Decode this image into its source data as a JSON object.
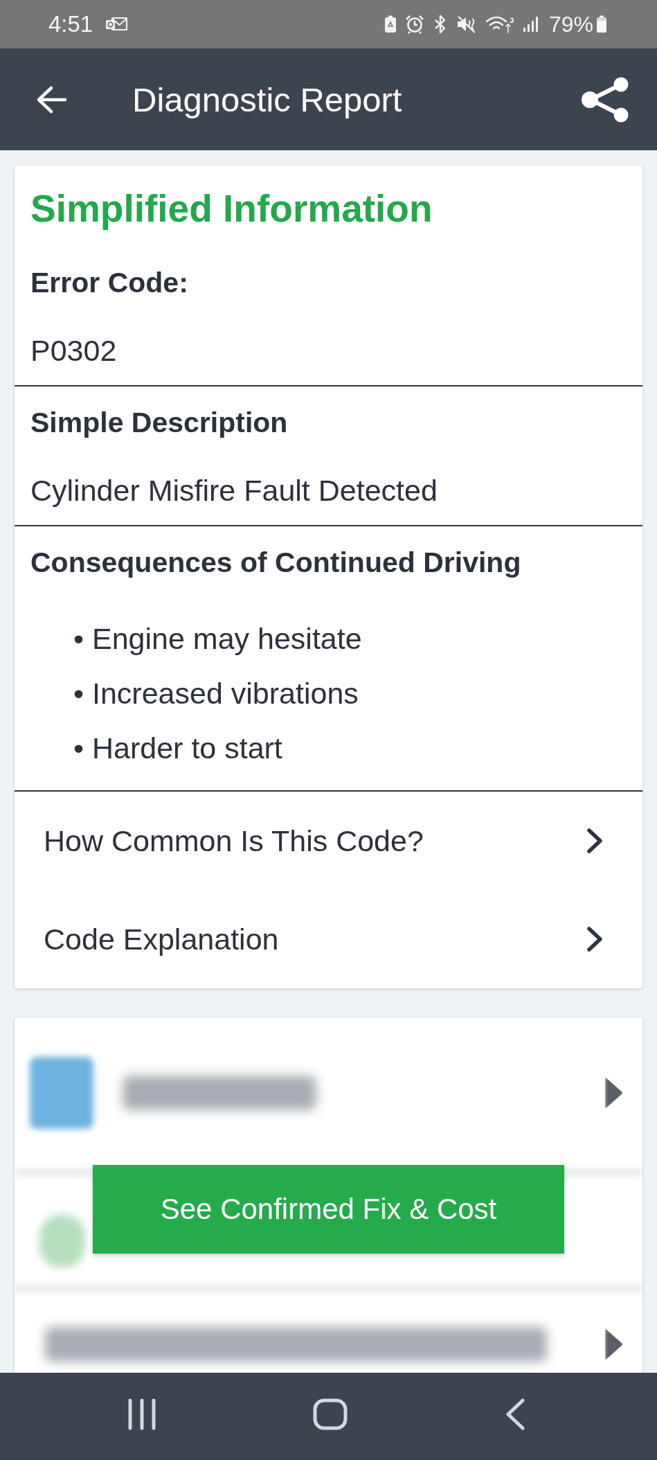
{
  "status_bar": {
    "time": "4:51",
    "battery": "79%"
  },
  "app_bar": {
    "title": "Diagnostic Report"
  },
  "info_card": {
    "title": "Simplified Information",
    "sections": [
      {
        "kind": "field",
        "label": "Error Code:",
        "value": "P0302"
      },
      {
        "kind": "field",
        "label": "Simple Description",
        "value": "Cylinder Misfire Fault Detected"
      },
      {
        "kind": "list",
        "label": "Consequences of Continued Driving",
        "items": [
          "• Engine may hesitate",
          "• Increased vibrations",
          "• Harder to start"
        ]
      }
    ],
    "links": [
      {
        "label": "How Common Is This Code?"
      },
      {
        "label": "Code Explanation"
      }
    ]
  },
  "locked_card": {
    "button": "See Confirmed Fix & Cost"
  }
}
